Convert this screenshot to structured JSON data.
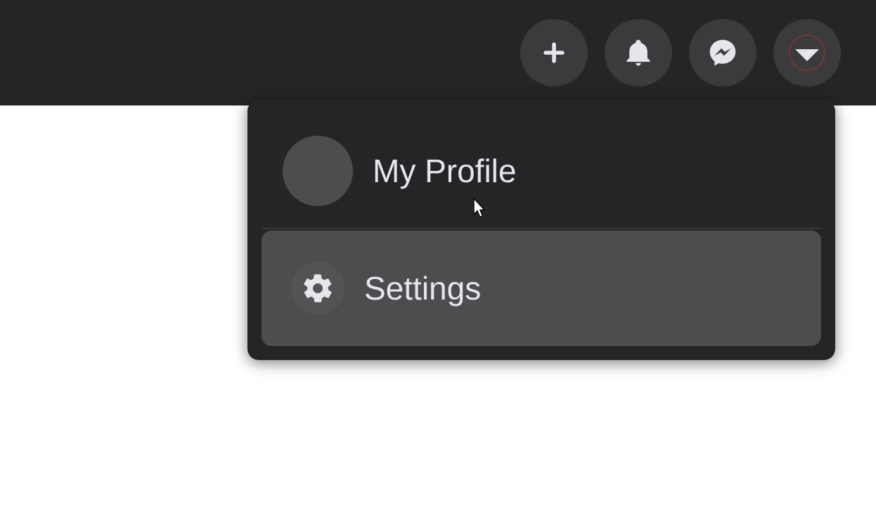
{
  "topbar": {
    "icons": {
      "create": "plus-icon",
      "notifications": "bell-icon",
      "messenger": "messenger-icon",
      "account": "chevron-down-icon"
    }
  },
  "dropdown": {
    "profile_label": "My Profile",
    "settings_label": "Settings"
  }
}
